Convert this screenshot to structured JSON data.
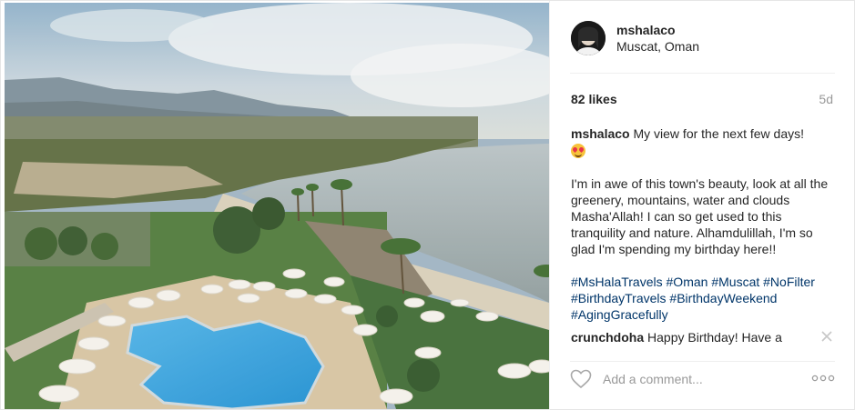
{
  "post": {
    "username": "mshalaco",
    "location": "Muscat, Oman",
    "likes": "82 likes",
    "age": "5d",
    "caption": {
      "username": "mshalaco",
      "line1": "My view for the next few days!",
      "body": "I'm in awe of this town's beauty, look at all the greenery, mountains, water and clouds Masha'Allah! I can so get used to this tranquility and nature. Alhamdulillah, I'm so glad I'm spending my birthday here!!",
      "hashtags": [
        "#MsHalaTravels",
        "#Oman",
        "#Muscat",
        "#NoFilter",
        "#BirthdayTravels",
        "#BirthdayWeekend",
        "#AgingGracefully"
      ]
    },
    "comments": [
      {
        "username": "crunchdoha",
        "text": "Happy Birthday! Have a"
      }
    ],
    "add_comment_placeholder": "Add a comment...",
    "icons": {
      "heart": "heart-icon",
      "more": "more-options-icon",
      "close": "close-icon",
      "emoji": "heart-eyes-emoji"
    }
  }
}
